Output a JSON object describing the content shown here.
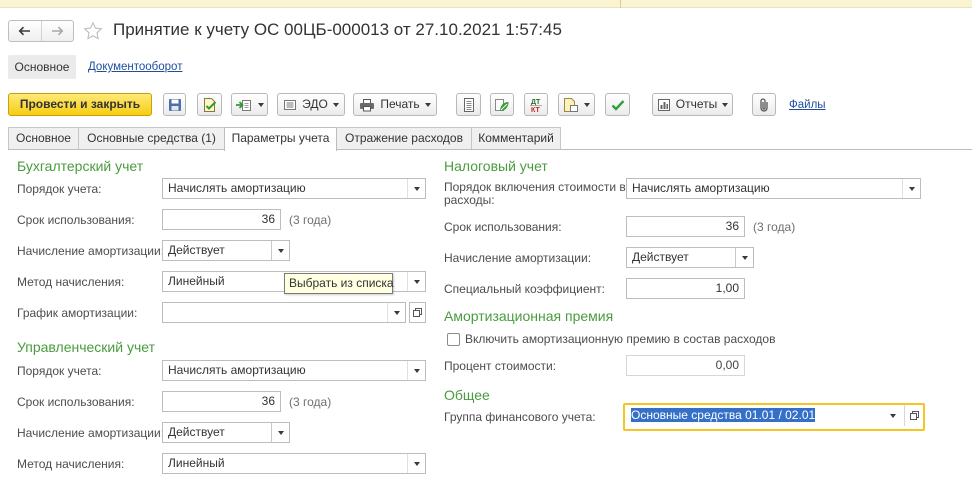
{
  "window": {
    "title": "Принятие к учету ОС 00ЦБ-000013 от 27.10.2021 1:57:45"
  },
  "nav": {
    "icons": {
      "back": "arrow-left-icon",
      "forward": "arrow-right-icon",
      "favorite": "star-icon"
    }
  },
  "subnav": {
    "main": "Основное",
    "docflow": "Документооборот"
  },
  "toolbar": {
    "post_and_close": "Провести и закрыть",
    "edo": "ЭДО",
    "print": "Печать",
    "reports": "Отчеты",
    "files": "Файлы",
    "dt_kt_icon_text": {
      "top": "ДТ",
      "bottom": "КТ"
    },
    "icons": [
      "save-icon",
      "post-document-icon",
      "create-based-on-icon",
      "edo-icon",
      "print-icon",
      "journal-icon",
      "structure-icon",
      "dt-kt-icon",
      "attach-document-icon",
      "check-icon",
      "reports-icon",
      "paperclip-icon"
    ]
  },
  "tabs": [
    {
      "label": "Основное",
      "active": false
    },
    {
      "label": "Основные средства (1)",
      "active": false
    },
    {
      "label": "Параметры учета",
      "active": true
    },
    {
      "label": "Отражение расходов",
      "active": false
    },
    {
      "label": "Комментарий",
      "active": false
    }
  ],
  "accounting": {
    "heading": "Бухгалтерский учет",
    "order": {
      "label": "Порядок учета:",
      "value": "Начислять амортизацию"
    },
    "term": {
      "label": "Срок использования:",
      "value": "36",
      "hint": "(3 года)"
    },
    "depreciation": {
      "label": "Начисление амортизации:",
      "value": "Действует"
    },
    "method": {
      "label": "Метод начисления:",
      "value": "Линейный"
    },
    "schedule": {
      "label": "График амортизации:"
    }
  },
  "tooltip": {
    "text": "Выбрать из списка"
  },
  "management": {
    "heading": "Управленческий учет",
    "order": {
      "label": "Порядок учета:",
      "value": "Начислять амортизацию"
    },
    "term": {
      "label": "Срок использования:",
      "value": "36",
      "hint": "(3 года)"
    },
    "depreciation": {
      "label": "Начисление амортизации:",
      "value": "Действует"
    },
    "method": {
      "label": "Метод начисления:",
      "value": "Линейный"
    }
  },
  "tax": {
    "heading": "Налоговый учет",
    "expense_order": {
      "label_lines": [
        "Порядок включения стоимости в",
        "расходы:"
      ],
      "value": "Начислять амортизацию"
    },
    "term": {
      "label": "Срок использования:",
      "value": "36",
      "hint": "(3 года)"
    },
    "depreciation": {
      "label": "Начисление амортизации:",
      "value": "Действует"
    },
    "special_ratio": {
      "label": "Специальный коэффициент:",
      "value": "1,00"
    }
  },
  "bonus": {
    "heading": "Амортизационная премия",
    "include": {
      "label": "Включить амортизационную премию в состав расходов",
      "checked": false
    },
    "percent": {
      "label": "Процент стоимости:",
      "value": "0,00",
      "enabled": false
    }
  },
  "general": {
    "heading": "Общее",
    "financial_group": {
      "label": "Группа финансового учета:",
      "value": "Основные средства 01.01 / 02.01",
      "focused": true,
      "text_selected": true
    }
  },
  "colors": {
    "section_heading": "#4A9B3F",
    "primary_button": "#F9D42C",
    "focus_border": "#F3C623",
    "selection": "#3570C8",
    "link": "#1F4E9C",
    "tooltip_bg": "#FFFFE1"
  }
}
